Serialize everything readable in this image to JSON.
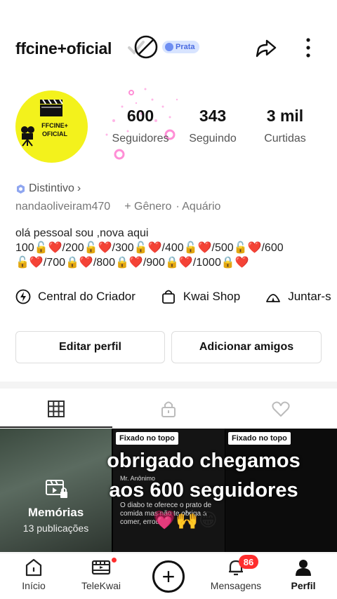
{
  "header": {
    "username": "ffcine+oficial",
    "badge_label": "Prata"
  },
  "avatar": {
    "text": "FFCINE+ OFICIAL"
  },
  "stats": [
    {
      "value": "600",
      "label": "Seguidores"
    },
    {
      "value": "343",
      "label": "Seguindo"
    },
    {
      "value": "3 mil",
      "label": "Curtidas"
    }
  ],
  "profile": {
    "distintivo": "Distintivo",
    "handle": "nandaoliveiram470",
    "gender": "+ Gênero",
    "sign": "· Aquário",
    "bio_line1": "olá pessoal sou ,nova aqui",
    "bio_line2": "100🔓❤️/200🔓❤️/300🔓❤️/400🔓❤️/500🔓❤️/600",
    "bio_line3": "🔓❤️/700🔒❤️/800🔒❤️/900🔒❤️/1000🔒❤️"
  },
  "links": [
    {
      "label": "Central do Criador",
      "icon": "lightning-icon"
    },
    {
      "label": "Kwai Shop",
      "icon": "shopping-bag-icon"
    },
    {
      "label": "Juntar-s",
      "icon": "tent-icon"
    }
  ],
  "actions": {
    "edit": "Editar perfil",
    "add": "Adicionar amigos"
  },
  "grid": {
    "memories_title": "Memórias",
    "memories_count": "13 publicações",
    "pinned_label": "Fixado no topo",
    "anon_name": "Mr. Anônimo",
    "video_small_text": "O diabo te oferece o prato de comida mas não te obriga a comer, errou...",
    "overlay_line1": "obrigado chegamos",
    "overlay_line2": "aos 600 seguidores",
    "emojis": "💗🙌😁"
  },
  "bottom_nav": {
    "home": "Início",
    "telekwai": "TeleKwai",
    "messages": "Mensagens",
    "messages_badge": "86",
    "profile": "Perfil"
  },
  "colors": {
    "accent_red": "#ff2d2d",
    "badge_blue": "#4a6be0",
    "avatar_yellow": "#f3f21c"
  }
}
